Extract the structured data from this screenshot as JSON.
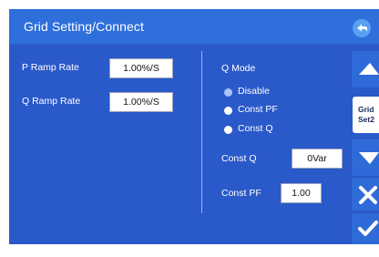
{
  "header": {
    "title": "Grid Setting/Connect",
    "back_icon": "back-arrow-icon"
  },
  "left": {
    "p_ramp": {
      "label": "P Ramp Rate",
      "value": "1.00%/S"
    },
    "q_ramp": {
      "label": "Q Ramp Rate",
      "value": "1.00%/S"
    }
  },
  "qmode": {
    "title": "Q Mode",
    "options": [
      "Disable",
      "Const PF",
      "Const Q"
    ],
    "selected": "Disable",
    "const_q": {
      "label": "Const Q",
      "value": "0Var"
    },
    "const_pf": {
      "label": "Const PF",
      "value": "1.00"
    }
  },
  "side": {
    "grid_set_line1": "Grid",
    "grid_set_line2": "Set2",
    "icons": [
      "up-arrow-icon",
      "down-arrow-icon",
      "close-icon",
      "check-icon"
    ]
  },
  "colors": {
    "background": "#2a59c9",
    "title_bar": "#2e6fdc",
    "selected_radio": "#aac4f6"
  }
}
